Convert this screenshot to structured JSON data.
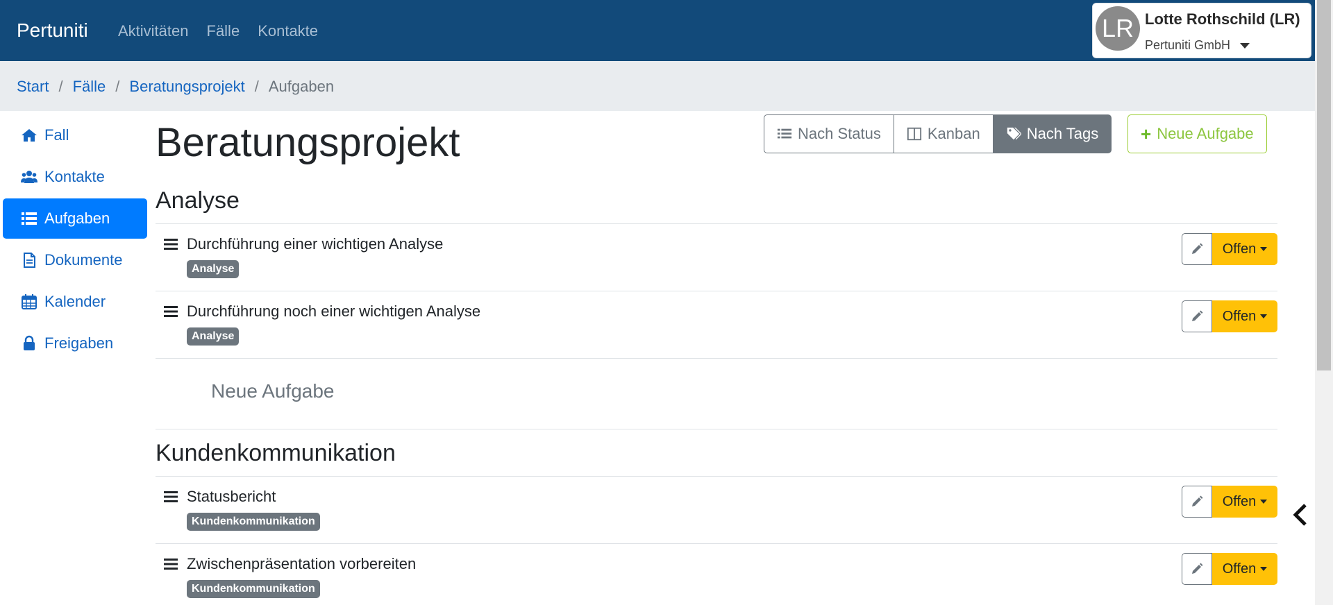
{
  "navbar": {
    "brand": "Pertuniti",
    "links": [
      "Aktivitäten",
      "Fälle",
      "Kontakte"
    ]
  },
  "user": {
    "initials": "LR",
    "name": "Lotte Rothschild (LR)",
    "organization": "Pertuniti GmbH"
  },
  "breadcrumb": [
    "Start",
    "Fälle",
    "Beratungsprojekt",
    "Aufgaben"
  ],
  "sidebar": {
    "items": [
      {
        "label": "Fall",
        "icon": "home-icon",
        "active": false
      },
      {
        "label": "Kontakte",
        "icon": "users-icon",
        "active": false
      },
      {
        "label": "Aufgaben",
        "icon": "list-icon",
        "active": true
      },
      {
        "label": "Dokumente",
        "icon": "document-icon",
        "active": false
      },
      {
        "label": "Kalender",
        "icon": "calendar-icon",
        "active": false
      },
      {
        "label": "Freigaben",
        "icon": "lock-icon",
        "active": false
      }
    ]
  },
  "main": {
    "title": "Beratungsprojekt",
    "view_buttons": [
      {
        "label": "Nach Status",
        "icon": "list-icon",
        "active": false
      },
      {
        "label": "Kanban",
        "icon": "columns-icon",
        "active": false
      },
      {
        "label": "Nach Tags",
        "icon": "tags-icon",
        "active": true
      }
    ],
    "new_task_button": "Neue Aufgabe",
    "sections": [
      {
        "title": "Analyse",
        "tasks": [
          {
            "title": "Durchführung einer wichtigen Analyse",
            "tag": "Analyse",
            "status": "Offen"
          },
          {
            "title": "Durchführung noch einer wichtigen Analyse",
            "tag": "Analyse",
            "status": "Offen"
          }
        ],
        "new_task_placeholder": "Neue Aufgabe"
      },
      {
        "title": "Kundenkommunikation",
        "tasks": [
          {
            "title": "Statusbericht",
            "tag": "Kundenkommunikation",
            "status": "Offen"
          },
          {
            "title": "Zwischenpräsentation vorbereiten",
            "tag": "Kundenkommunikation",
            "status": "Offen"
          }
        ]
      }
    ]
  },
  "colors": {
    "navbar": "#124a7a",
    "link": "#1565c0",
    "active": "#007bff",
    "status_open": "#ffc107",
    "tag": "#6c757d",
    "success": "#8cc63f"
  }
}
